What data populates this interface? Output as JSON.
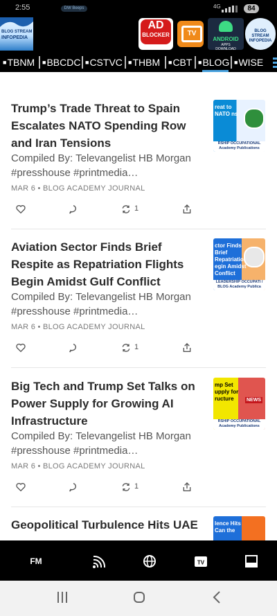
{
  "status_bar": {
    "time": "2:55",
    "notif_pill": "DW Beeps",
    "network": "4G",
    "battery": "84"
  },
  "header": {
    "logo_line1": "BLOG STREAM",
    "logo_line2": "INFOPEDIA",
    "apps": [
      {
        "name": "ad-blocker",
        "label1": "AD",
        "label2": "BLOCKER"
      },
      {
        "name": "tv",
        "label": "TV"
      },
      {
        "name": "android",
        "label1": "ANDROID",
        "label2": "APPS DOWNLOAD"
      },
      {
        "name": "blog-stream",
        "label1": "BLOG STREAM",
        "label2": "INFOPEDIA"
      }
    ]
  },
  "nav": {
    "tabs": [
      "TBNM",
      "BBCDC",
      "CSTVC",
      "THBM",
      "CBT",
      "BLOG",
      "WISE"
    ],
    "active": "BLOG"
  },
  "posts": [
    {
      "title": "Trump’s Trade Threat to Spain Escalates NATO Spending Row and Iran Tensions",
      "excerpt": "Compiled By: Televangelist HB Morgan #presshouse #printmedia…",
      "meta": "MAR 6 • BLOG ACADEMY JOURNAL",
      "restacks": "1",
      "thumb_text": "reat to NATO ns",
      "thumb_band": "RSHIP OCCUPATIONAL Academy Publications"
    },
    {
      "title": "Aviation Sector Finds Brief Respite as Repatriation Flights Begin Amidst Gulf Conflict",
      "excerpt": "Compiled By: Televangelist HB Morgan #presshouse #printmedia…",
      "meta": "MAR 6 • BLOG ACADEMY JOURNAL",
      "restacks": "1",
      "thumb_text": "ctor Finds Brief Repatriation egin Amidst Conflict",
      "thumb_band": "LEADERSHIP OCCUPATI / BLOG Academy Publica"
    },
    {
      "title": "Big Tech and Trump Set Talks on Power Supply for Growing AI Infrastructure",
      "excerpt": "Compiled By: Televangelist HB Morgan #presshouse #printmedia…",
      "meta": "MAR 6 • BLOG ACADEMY JOURNAL",
      "restacks": "1",
      "thumb_text": "mp Set upply for ructure",
      "thumb_band": "RSHIP OCCUPATIONAL Academy Publications"
    },
    {
      "title": "Geopolitical Turbulence Hits UAE",
      "thumb_text": "lence Hits Can the"
    }
  ],
  "bottom_toolbar": {
    "fm": "FM"
  },
  "colors": {
    "accent": "#4aa3df",
    "header_bg": "#000000",
    "title": "#2b2b2b"
  }
}
